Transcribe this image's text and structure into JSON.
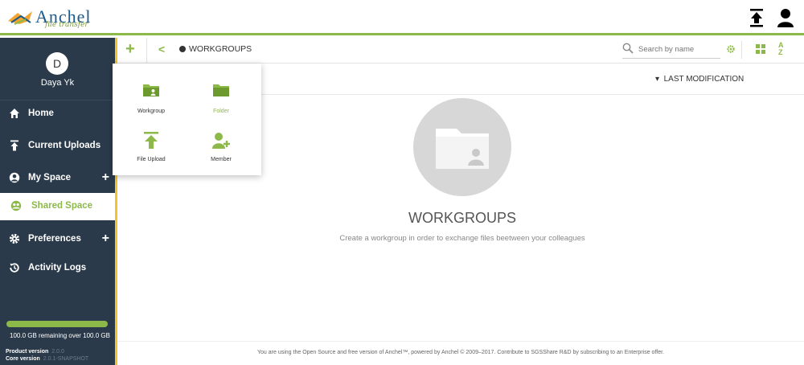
{
  "app": {
    "logo_text": "Anchel",
    "logo_tagline": "file transfer"
  },
  "sidebar": {
    "user": {
      "initial": "D",
      "name": "Daya Yk"
    },
    "items": [
      {
        "label": "Home",
        "icon": "home-icon",
        "has_add": false,
        "active": false
      },
      {
        "label": "Current Uploads",
        "icon": "upload-icon",
        "has_add": false,
        "active": false
      },
      {
        "label": "My Space",
        "icon": "user-circle-icon",
        "has_add": true,
        "active": false
      },
      {
        "label": "Shared Space",
        "icon": "group-icon",
        "has_add": false,
        "active": true
      },
      {
        "label": "Preferences",
        "icon": "gear-icon",
        "has_add": true,
        "active": false
      },
      {
        "label": "Activity Logs",
        "icon": "history-icon",
        "has_add": false,
        "active": false
      }
    ],
    "add_symbol": "+",
    "quota": {
      "text": "100.0 GB remaining over 100.0 GB",
      "fraction_used": 0.0
    },
    "product_version": {
      "label": "Product version",
      "value": "2.0.0"
    },
    "core_version": {
      "label": "Core version",
      "value": "2.0.1-SNAPSHOT"
    }
  },
  "toolbar": {
    "add_symbol": "+",
    "back_symbol": "<",
    "breadcrumb": "WORKGROUPS",
    "search_placeholder": "Search by name"
  },
  "sort": {
    "label": "LAST MODIFICATION",
    "arrow": "▾"
  },
  "empty_state": {
    "title": "WORKGROUPS",
    "description": "Create a workgroup in order to exchange files beetween your colleagues"
  },
  "popup_menu": {
    "items": [
      {
        "label": "Workgroup",
        "icon": "workgroup-icon",
        "highlight": false
      },
      {
        "label": "Folder",
        "icon": "folder-icon",
        "highlight": true
      },
      {
        "label": "File Upload",
        "icon": "file-upload-icon",
        "highlight": false
      },
      {
        "label": "Member",
        "icon": "add-member-icon",
        "highlight": false
      }
    ]
  },
  "footer": {
    "text": "You are using the Open Source and free version of Anchel™, powered by Anchel © 2009–2017. Contribute to SGSShare R&D by subscribing to an Enterprise offer."
  },
  "colors": {
    "accent": "#8db84a",
    "sidebar_bg": "#2b3a4a",
    "sidebar_edge": "#f2c230",
    "logo_blue": "#1c5a8c"
  }
}
